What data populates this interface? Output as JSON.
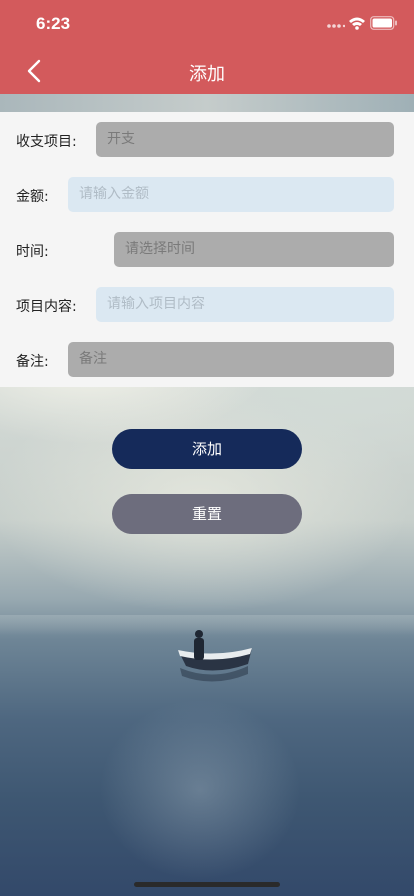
{
  "status_bar": {
    "time": "6:23"
  },
  "navbar": {
    "title": "添加"
  },
  "form": {
    "rows": [
      {
        "label": "收支项目:",
        "value": "开支",
        "placeholder": ""
      },
      {
        "label": "金额:",
        "value": "",
        "placeholder": "请输入金额"
      },
      {
        "label": "时间:",
        "value": "",
        "placeholder": "请选择时间"
      },
      {
        "label": "项目内容:",
        "value": "",
        "placeholder": "请输入项目内容"
      },
      {
        "label": "备注:",
        "value": "",
        "placeholder": "备注"
      }
    ]
  },
  "buttons": {
    "add": "添加",
    "reset": "重置"
  },
  "colors": {
    "header": "#d35a5c",
    "add_button": "#152a5a",
    "reset_button": "#6d6d7d"
  },
  "icons": {
    "back": "chevron-left-icon",
    "wifi": "wifi-icon",
    "signal": "signal-icon",
    "battery": "battery-icon"
  }
}
